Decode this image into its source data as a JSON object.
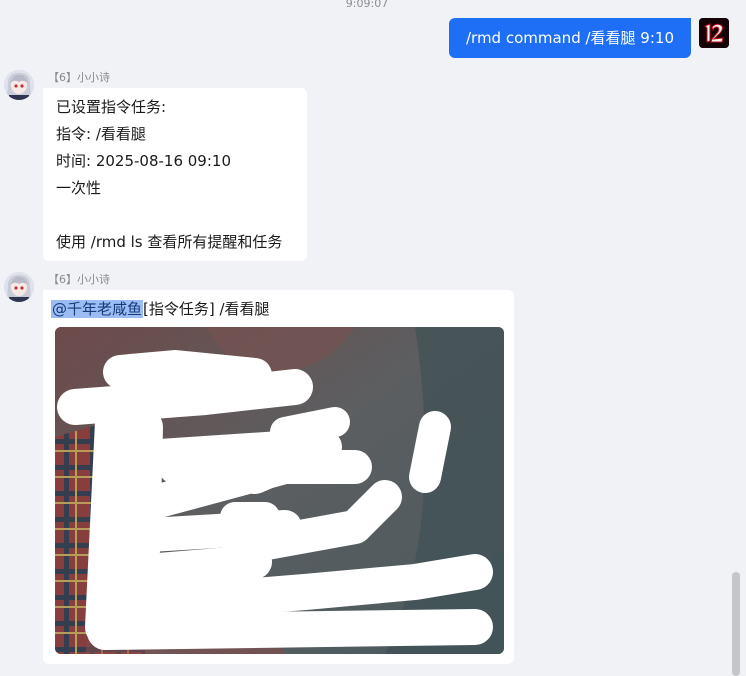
{
  "conversation": {
    "timestamp": "9:09:07",
    "outgoing": {
      "text": "/rmd command /看看腿 9:10",
      "avatar_icon": "game-logo-avatar",
      "bubble_color": "#1e6ff5"
    },
    "messages": [
      {
        "sender": "【6】小小诗",
        "avatar_icon": "anime-girl-avatar",
        "lines": [
          "已设置指令任务:",
          "指令: /看看腿",
          "时间: 2025-08-16 09:10",
          "一次性",
          "",
          "使用 /rmd ls 查看所有提醒和任务"
        ]
      },
      {
        "sender": "【6】小小诗",
        "avatar_icon": "anime-girl-avatar",
        "mention": "@千年老咸鱼",
        "text_after_mention": "[指令任务] /看看腿",
        "image_icon": "censored-photo"
      }
    ]
  },
  "colors": {
    "background": "#f1f2f6",
    "mention_highlight": "#9cbdf3",
    "bubble_incoming": "#ffffff"
  }
}
